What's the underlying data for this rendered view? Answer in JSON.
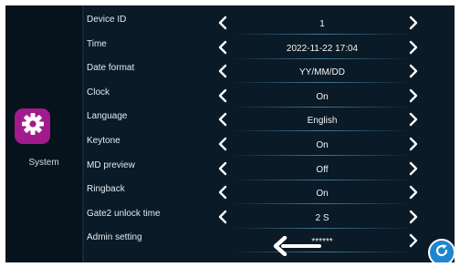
{
  "sidebar": {
    "app_label": "System",
    "app_icon": "gear-icon",
    "app_color": "#a11b8c"
  },
  "settings": [
    {
      "key": "device-id",
      "label": "Device ID",
      "value": "1",
      "has_left_arrow": true,
      "has_right_arrow": true
    },
    {
      "key": "time",
      "label": "Time",
      "value": "2022-11-22  17:04",
      "has_left_arrow": true,
      "has_right_arrow": true
    },
    {
      "key": "date-format",
      "label": "Date format",
      "value": "YY/MM/DD",
      "has_left_arrow": true,
      "has_right_arrow": true
    },
    {
      "key": "clock",
      "label": "Clock",
      "value": "On",
      "has_left_arrow": true,
      "has_right_arrow": true
    },
    {
      "key": "language",
      "label": "Language",
      "value": "English",
      "has_left_arrow": true,
      "has_right_arrow": true
    },
    {
      "key": "keytone",
      "label": "Keytone",
      "value": "On",
      "has_left_arrow": true,
      "has_right_arrow": true
    },
    {
      "key": "md-preview",
      "label": "MD preview",
      "value": "Off",
      "has_left_arrow": true,
      "has_right_arrow": true
    },
    {
      "key": "ringback",
      "label": "Ringback",
      "value": "On",
      "has_left_arrow": true,
      "has_right_arrow": true
    },
    {
      "key": "gate2-unlock-time",
      "label": "Gate2 unlock time",
      "value": "2 S",
      "has_left_arrow": true,
      "has_right_arrow": true
    },
    {
      "key": "admin-setting",
      "label": "Admin setting",
      "value": "******",
      "has_left_arrow": false,
      "has_right_arrow": true
    }
  ],
  "overlay": {
    "pointer_arrow_icon": "left-arrow-icon",
    "pointer_arrow_color": "#ffffff"
  },
  "corner_button": {
    "icon": "refresh-icon",
    "color": "#1e86d0"
  },
  "colors": {
    "screen_bg": "#0a1a26",
    "sidebar_bg": "#06121c",
    "text": "#e4eaef"
  }
}
